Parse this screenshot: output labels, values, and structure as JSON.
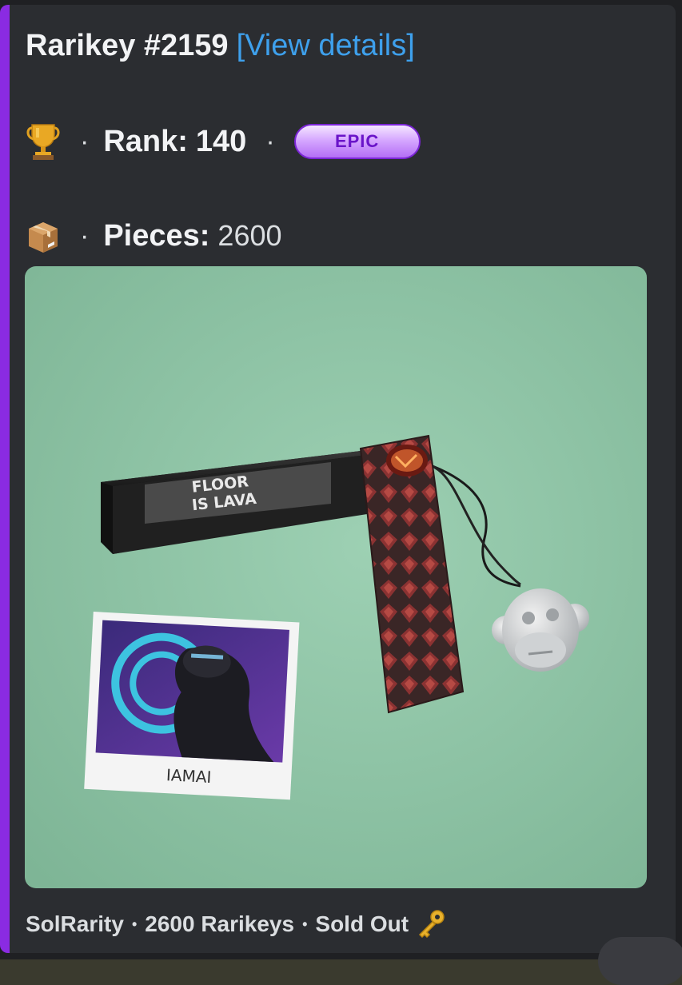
{
  "embed": {
    "accent_color": "#8a2be2",
    "title": "Rarikey #2159",
    "title_link": "[View details]",
    "rank": {
      "icon": "trophy-icon",
      "separator": "·",
      "label": "Rank:",
      "value": "140",
      "separator2": "·",
      "badge": "EPIC",
      "badge_color": "#b46ef5"
    },
    "pieces": {
      "icon": "package-icon",
      "separator": "·",
      "label": "Pieces:",
      "value": "2600"
    },
    "image": {
      "plate_text_line1": "FLOOR",
      "plate_text_line2": "IS LAVA",
      "card_caption": "IAMAI",
      "background_color": "#8fc4a8"
    },
    "footer": {
      "brand": "SolRarity",
      "bullet": "•",
      "count": "2600 Rarikeys",
      "status": "Sold Out",
      "icon": "key-icon"
    }
  }
}
